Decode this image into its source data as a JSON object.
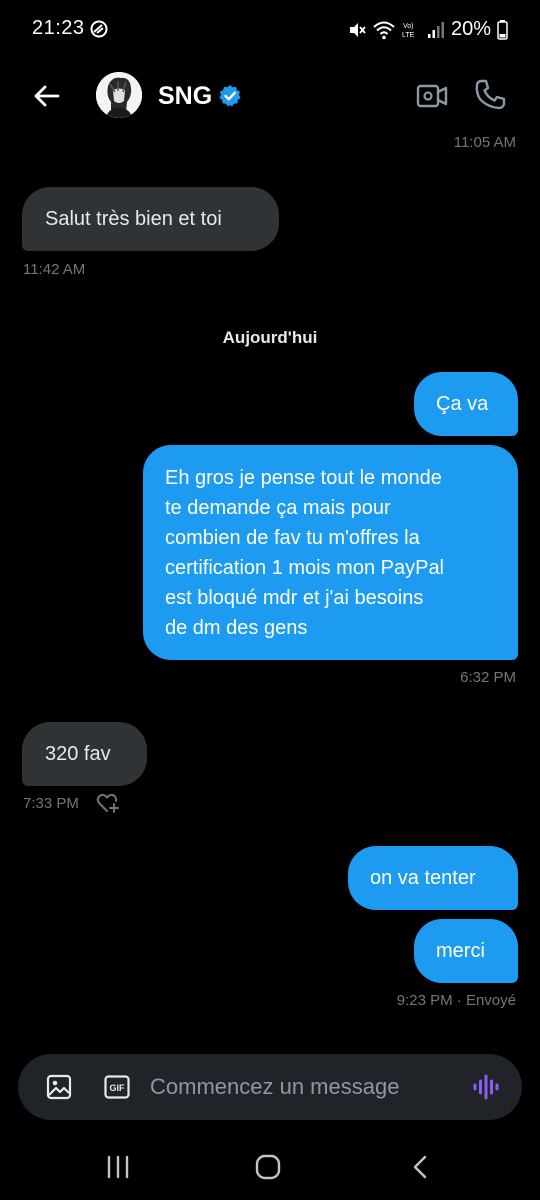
{
  "status_bar": {
    "time": "21:23",
    "battery": "20%",
    "icons": [
      "alarm-icon",
      "mute-icon",
      "wifi-icon",
      "volte-icon",
      "signal-icon",
      "battery-icon"
    ]
  },
  "header": {
    "name": "SNG",
    "verified": true,
    "back_icon": "arrow-left-icon",
    "video_icon": "video-camera-icon",
    "call_icon": "phone-icon"
  },
  "messages": [
    {
      "direction": "incoming",
      "text": "Salut très bien et toi",
      "time": "11:42 AM"
    },
    {
      "direction": "outgoing",
      "text": "Ça va"
    },
    {
      "direction": "outgoing",
      "text": "Eh gros je pense tout le monde\nte demande ça mais pour\ncombien de fav tu m'offres la\ncertification 1 mois mon PayPal\nest bloqué mdr et j'ai besoins\nde dm des gens",
      "time": "6:32 PM"
    },
    {
      "direction": "incoming",
      "text": "320 fav",
      "time": "7:33 PM"
    },
    {
      "direction": "outgoing",
      "text": "on va tenter"
    },
    {
      "direction": "outgoing",
      "text": "merci",
      "time": "9:23 PM · Envoyé"
    }
  ],
  "earlier_timestamp": "11:05 AM",
  "day_separator": "Aujourd'hui",
  "composer": {
    "placeholder": "Commencez un message",
    "gif_label": "GIF"
  },
  "colors": {
    "background": "#000000",
    "incoming_bubble": "#2f3336",
    "outgoing_bubble": "#1d9bf0",
    "timestamp": "#71767b",
    "verified": "#1d9bf0",
    "voice_accent": "#8b5cf6"
  }
}
